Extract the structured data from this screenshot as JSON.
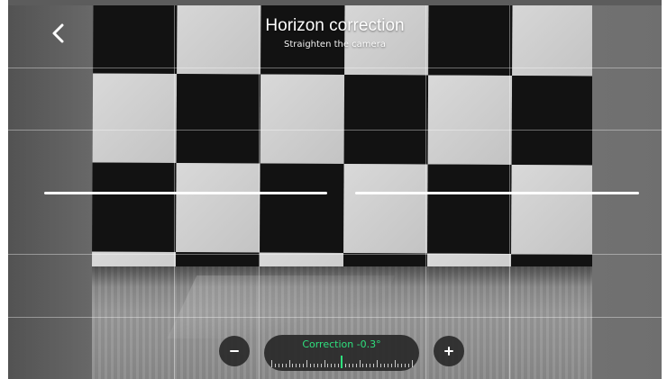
{
  "header": {
    "title": "Horizon correction",
    "subtitle": "Straighten the camera"
  },
  "controls": {
    "back_icon": "chevron-left-icon",
    "decrease_icon": "minus-icon",
    "increase_icon": "plus-icon",
    "decrease_label": "−",
    "increase_label": "+"
  },
  "slider": {
    "label": "Correction -0.3°",
    "value": -0.3,
    "unit": "°"
  },
  "colors": {
    "accent": "#2fe07e",
    "horizon_line": "#ffffff",
    "control_bg": "#282828"
  }
}
